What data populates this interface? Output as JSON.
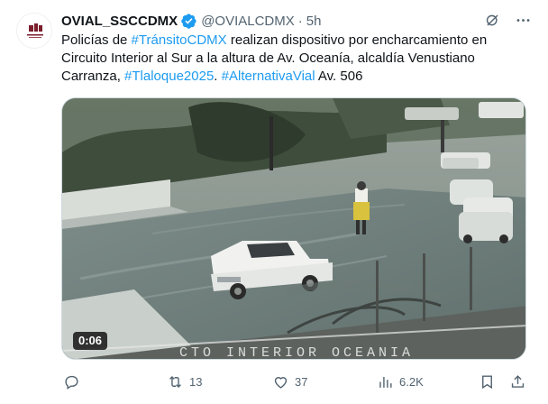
{
  "author": {
    "name": "OVIAL_SSCCDMX",
    "handle": "@OVIALCDMX",
    "separator": "·",
    "time": "5h"
  },
  "tweet": {
    "parts": [
      {
        "text": "Policías de ",
        "tag": false
      },
      {
        "text": "#TránsitoCDMX",
        "tag": true
      },
      {
        "text": " realizan dispositivo por encharcamiento en Circuito Interior al Sur a la altura de Av. Oceanía, alcaldía Venustiano Carranza, ",
        "tag": false
      },
      {
        "text": "#Tlaloque2025",
        "tag": true
      },
      {
        "text": ". ",
        "tag": false
      },
      {
        "text": "#AlternativaVial",
        "tag": true
      },
      {
        "text": " Av. 506",
        "tag": false
      }
    ]
  },
  "media": {
    "duration": "0:06",
    "overlay_text": "CTO INTERIOR OCEANIA"
  },
  "actions": {
    "reply": "",
    "retweets": "13",
    "likes": "37",
    "views": "6.2K"
  },
  "icons": {
    "verified": "verified-badge-icon",
    "grok": "grok-icon",
    "more": "more-icon",
    "reply": "reply-icon",
    "retweet": "retweet-icon",
    "like": "heart-icon",
    "views": "views-icon",
    "bookmark": "bookmark-icon",
    "share": "share-icon"
  },
  "colors": {
    "accent": "#1d9bf0",
    "secondary_text": "#536471",
    "text": "#0f1419"
  }
}
